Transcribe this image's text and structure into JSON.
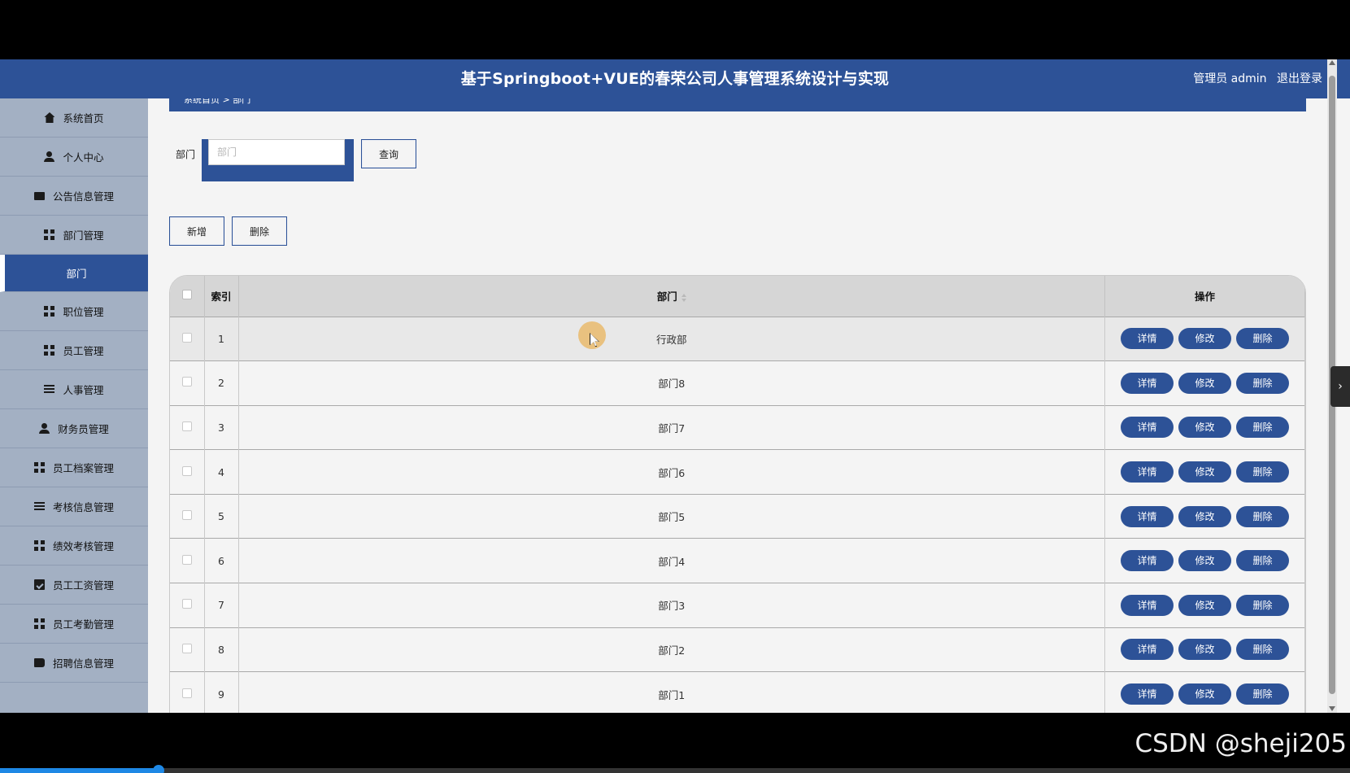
{
  "header": {
    "title": "基于Springboot+VUE的春荣公司人事管理系统设计与实现",
    "user": "管理员 admin",
    "logout": "退出登录"
  },
  "sidebar": {
    "items": [
      {
        "label": "系统首页",
        "icon": "home-icon"
      },
      {
        "label": "个人中心",
        "icon": "person-icon"
      },
      {
        "label": "公告信息管理",
        "icon": "monitor-icon"
      },
      {
        "label": "部门管理",
        "icon": "grid-icon"
      },
      {
        "label": "部门",
        "icon": ""
      },
      {
        "label": "职位管理",
        "icon": "grid-icon"
      },
      {
        "label": "员工管理",
        "icon": "grid-icon"
      },
      {
        "label": "人事管理",
        "icon": "list-icon"
      },
      {
        "label": "财务员管理",
        "icon": "person-icon"
      },
      {
        "label": "员工档案管理",
        "icon": "grid-icon"
      },
      {
        "label": "考核信息管理",
        "icon": "list-icon"
      },
      {
        "label": "绩效考核管理",
        "icon": "grid-icon"
      },
      {
        "label": "员工工资管理",
        "icon": "clipboard-check-icon"
      },
      {
        "label": "员工考勤管理",
        "icon": "grid-icon"
      },
      {
        "label": "招聘信息管理",
        "icon": "book-icon"
      }
    ]
  },
  "breadcrumb": "系统首页 > 部门",
  "search": {
    "label": "部门",
    "placeholder": "部门",
    "value": "",
    "button": "查询"
  },
  "actions": {
    "add": "新增",
    "delete": "删除"
  },
  "table": {
    "columns": {
      "index": "索引",
      "dept": "部门",
      "ops": "操作"
    },
    "op_labels": {
      "detail": "详情",
      "edit": "修改",
      "delete": "删除"
    },
    "rows": [
      {
        "index": "1",
        "dept": "行政部"
      },
      {
        "index": "2",
        "dept": "部门8"
      },
      {
        "index": "3",
        "dept": "部门7"
      },
      {
        "index": "4",
        "dept": "部门6"
      },
      {
        "index": "5",
        "dept": "部门5"
      },
      {
        "index": "6",
        "dept": "部门4"
      },
      {
        "index": "7",
        "dept": "部门3"
      },
      {
        "index": "8",
        "dept": "部门2"
      },
      {
        "index": "9",
        "dept": "部门1"
      }
    ]
  },
  "watermark": "CSDN @sheji205",
  "colors": {
    "primary": "#2d5297",
    "sidebar": "#a3b0c3",
    "background": "#f4f4f4"
  }
}
